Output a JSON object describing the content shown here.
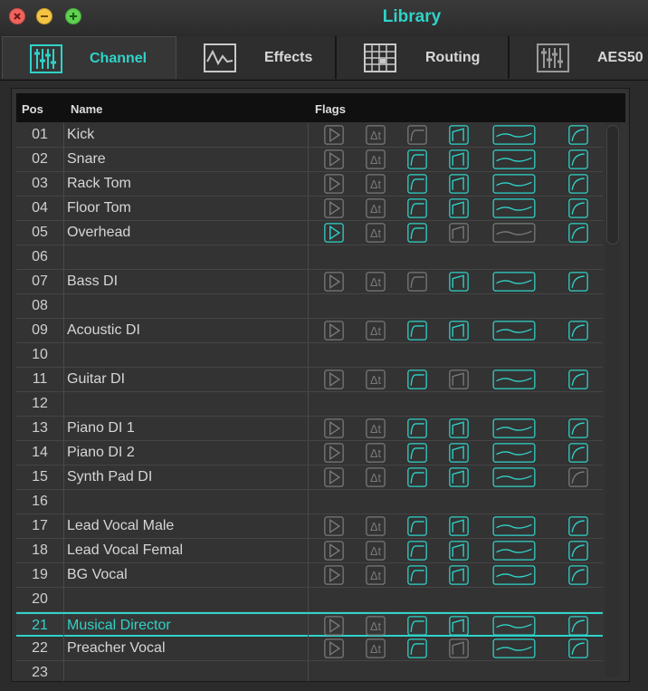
{
  "window": {
    "title": "Library"
  },
  "colors": {
    "accent": "#2fd3c9",
    "inactive": "#7a7a7a"
  },
  "tabs": [
    {
      "label": "Channel",
      "icon": "channel-faders-icon",
      "active": true
    },
    {
      "label": "Effects",
      "icon": "effects-waveform-icon",
      "active": false
    },
    {
      "label": "Routing",
      "icon": "routing-grid-icon",
      "active": false
    },
    {
      "label": "AES50",
      "icon": "aes50-faders-icon",
      "active": false
    }
  ],
  "table": {
    "columns": {
      "pos": "Pos",
      "name": "Name",
      "flags": "Flags"
    },
    "flag_icons": [
      "play-flag-icon",
      "delta-time-flag-icon",
      "gate-flag-icon",
      "dynamics-flag-icon",
      "eq-flag-icon",
      "compressor-flag-icon"
    ],
    "rows": [
      {
        "pos": "01",
        "name": "Kick",
        "flags": [
          0,
          0,
          0,
          1,
          1,
          1
        ]
      },
      {
        "pos": "02",
        "name": "Snare",
        "flags": [
          0,
          0,
          1,
          1,
          1,
          1
        ]
      },
      {
        "pos": "03",
        "name": "Rack Tom",
        "flags": [
          0,
          0,
          1,
          1,
          1,
          1
        ]
      },
      {
        "pos": "04",
        "name": "Floor Tom",
        "flags": [
          0,
          0,
          1,
          1,
          1,
          1
        ]
      },
      {
        "pos": "05",
        "name": "Overhead",
        "flags": [
          1,
          0,
          1,
          0,
          0,
          1
        ]
      },
      {
        "pos": "06",
        "name": "",
        "flags": null
      },
      {
        "pos": "07",
        "name": "Bass DI",
        "flags": [
          0,
          0,
          0,
          1,
          1,
          1
        ]
      },
      {
        "pos": "08",
        "name": "",
        "flags": null
      },
      {
        "pos": "09",
        "name": "Acoustic DI",
        "flags": [
          0,
          0,
          1,
          1,
          1,
          1
        ]
      },
      {
        "pos": "10",
        "name": "",
        "flags": null
      },
      {
        "pos": "11",
        "name": "Guitar DI",
        "flags": [
          0,
          0,
          1,
          0,
          1,
          1
        ]
      },
      {
        "pos": "12",
        "name": "",
        "flags": null
      },
      {
        "pos": "13",
        "name": "Piano DI 1",
        "flags": [
          0,
          0,
          1,
          1,
          1,
          1
        ]
      },
      {
        "pos": "14",
        "name": "Piano DI 2",
        "flags": [
          0,
          0,
          1,
          1,
          1,
          1
        ]
      },
      {
        "pos": "15",
        "name": "Synth Pad DI",
        "flags": [
          0,
          0,
          1,
          1,
          1,
          0
        ]
      },
      {
        "pos": "16",
        "name": "",
        "flags": null
      },
      {
        "pos": "17",
        "name": "Lead Vocal Male",
        "flags": [
          0,
          0,
          1,
          1,
          1,
          1
        ]
      },
      {
        "pos": "18",
        "name": "Lead Vocal Femal",
        "flags": [
          0,
          0,
          1,
          1,
          1,
          1
        ]
      },
      {
        "pos": "19",
        "name": "BG Vocal",
        "flags": [
          0,
          0,
          1,
          1,
          1,
          1
        ]
      },
      {
        "pos": "20",
        "name": "",
        "flags": null
      },
      {
        "pos": "21",
        "name": "Musical Director",
        "flags": [
          0,
          0,
          1,
          1,
          1,
          1
        ],
        "selected": true
      },
      {
        "pos": "22",
        "name": "Preacher Vocal",
        "flags": [
          0,
          0,
          1,
          0,
          1,
          1
        ]
      },
      {
        "pos": "23",
        "name": "",
        "flags": null
      }
    ]
  }
}
